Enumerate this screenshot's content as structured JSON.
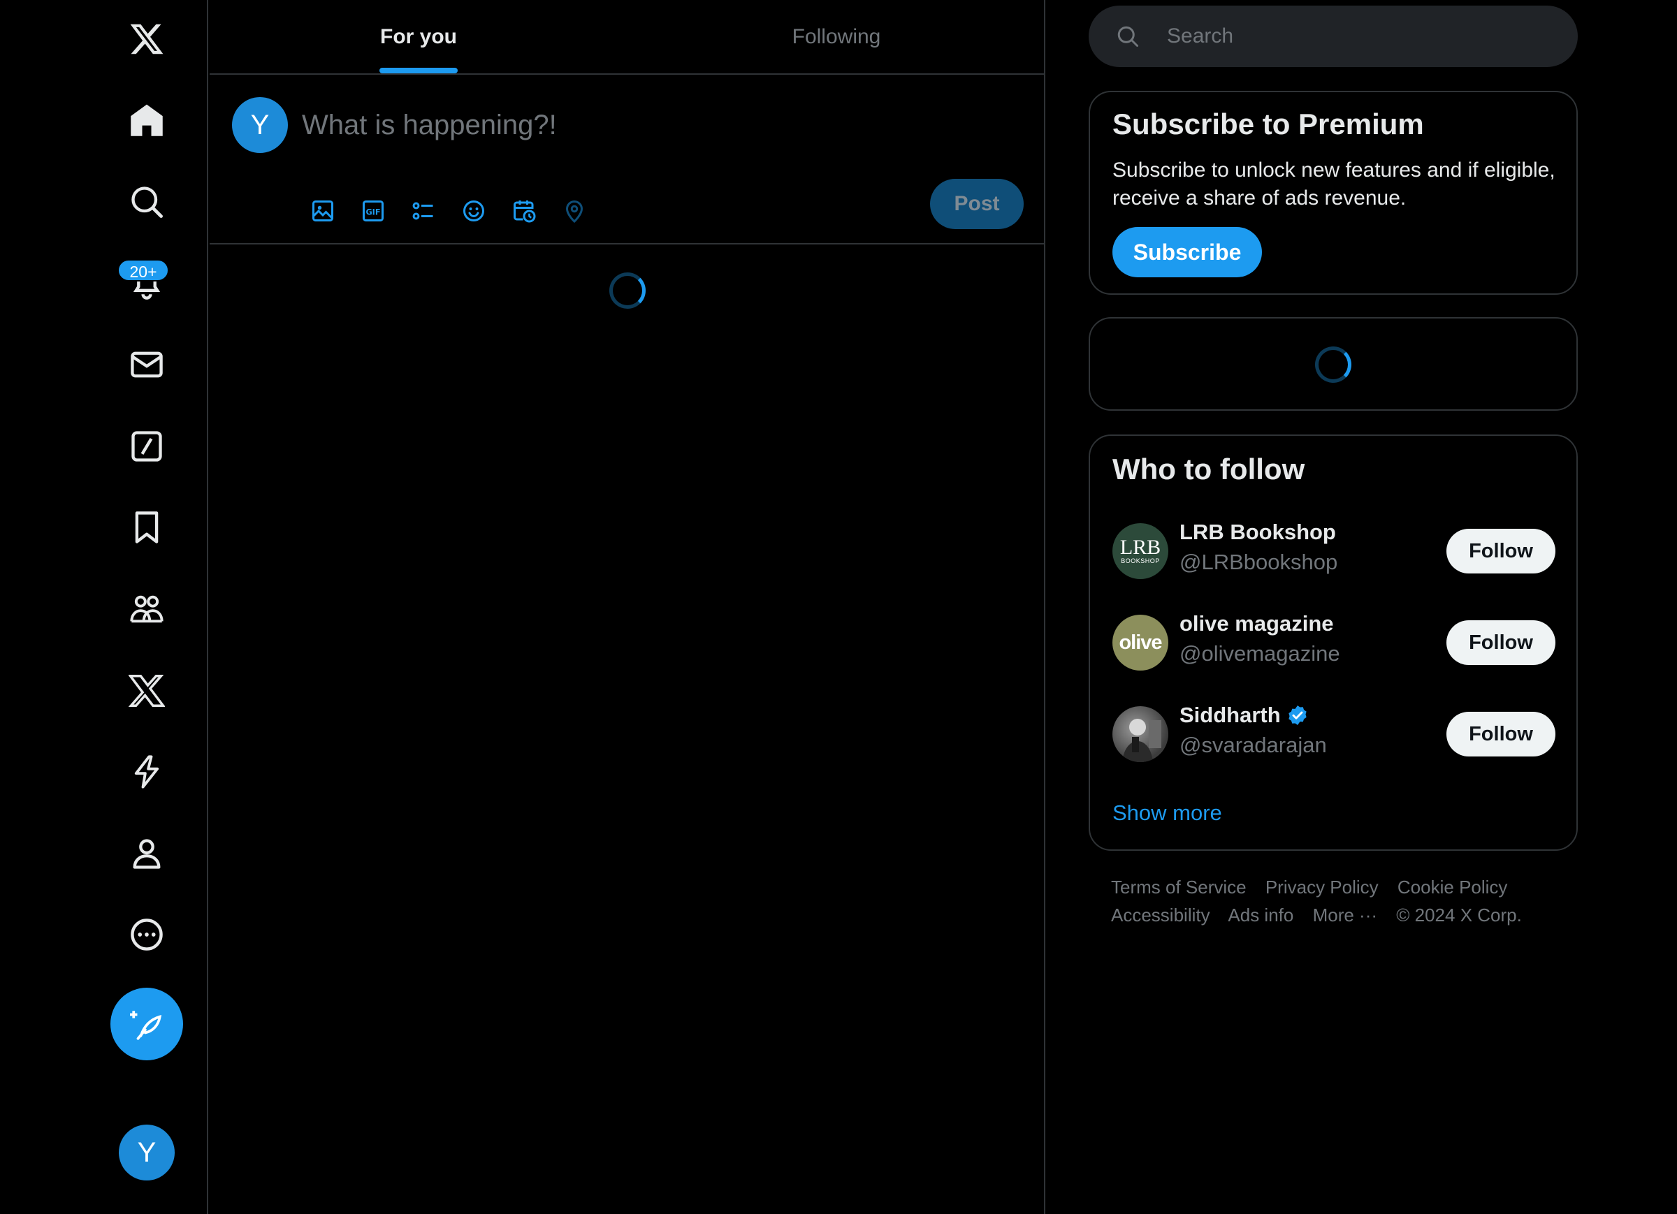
{
  "colors": {
    "accent": "#1d9bf0",
    "background": "#000000",
    "text": "#e7e9ea",
    "muted": "#71767b",
    "border": "#2f3336"
  },
  "nav": {
    "items": [
      {
        "icon": "x-logo-icon"
      },
      {
        "icon": "home-icon"
      },
      {
        "icon": "search-icon"
      },
      {
        "icon": "bell-icon"
      },
      {
        "icon": "mail-icon"
      },
      {
        "icon": "grok-icon"
      },
      {
        "icon": "bookmark-icon"
      },
      {
        "icon": "communities-icon"
      },
      {
        "icon": "premium-x-icon"
      },
      {
        "icon": "lightning-icon"
      },
      {
        "icon": "profile-icon"
      },
      {
        "icon": "more-circle-icon"
      }
    ],
    "notifications_badge": "20+",
    "compose_icon": "feather-plus-icon",
    "avatar_letter": "Y"
  },
  "main": {
    "tabs": [
      {
        "label": "For you",
        "active": true
      },
      {
        "label": "Following",
        "active": false
      }
    ],
    "composer": {
      "avatar_letter": "Y",
      "placeholder": "What is happening?!",
      "tools": [
        "image-icon",
        "gif-icon",
        "poll-icon",
        "emoji-icon",
        "schedule-icon",
        "location-icon"
      ],
      "post_label": "Post"
    }
  },
  "sidebar": {
    "search_placeholder": "Search",
    "premium": {
      "title": "Subscribe to Premium",
      "description": "Subscribe to unlock new features and if eligible, receive a share of ads revenue.",
      "button_label": "Subscribe"
    },
    "who_to_follow": {
      "title": "Who to follow",
      "accounts": [
        {
          "name": "LRB Bookshop",
          "handle": "@LRBbookshop",
          "avatar_text": "LRB",
          "avatar_subtext": "BOOKSHOP",
          "avatar_color": "#2c4a3a",
          "verified": false,
          "button": "Follow"
        },
        {
          "name": "olive magazine",
          "handle": "@olivemagazine",
          "avatar_text": "olive",
          "avatar_color": "#8c8f5c",
          "verified": false,
          "button": "Follow"
        },
        {
          "name": "Siddharth",
          "handle": "@svaradarajan",
          "avatar_text": "",
          "avatar_color": "#5a5a5a",
          "verified": true,
          "button": "Follow"
        }
      ],
      "show_more": "Show more"
    },
    "footer": {
      "links": [
        "Terms of Service",
        "Privacy Policy",
        "Cookie Policy",
        "Accessibility",
        "Ads info",
        "More ···",
        "© 2024 X Corp."
      ]
    }
  }
}
